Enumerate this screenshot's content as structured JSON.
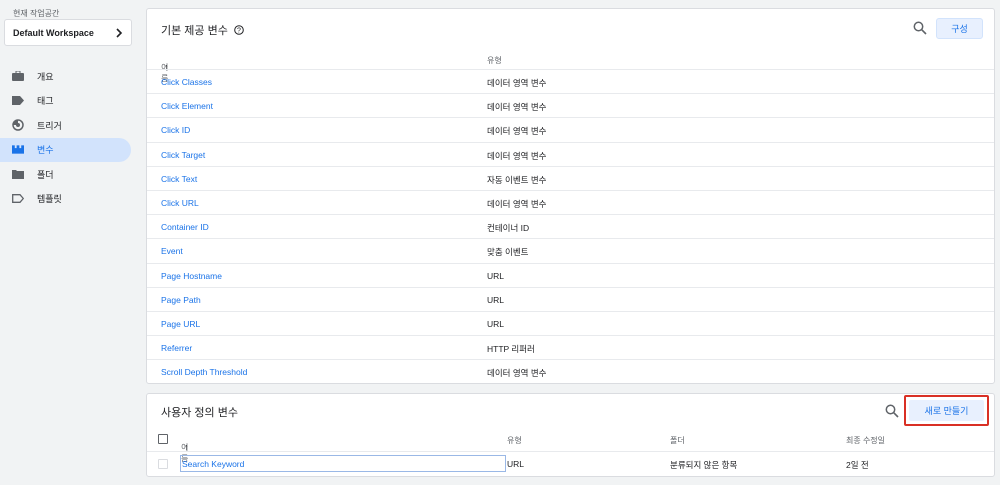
{
  "sidebar": {
    "workspace_label": "현재 작업공간",
    "workspace_name": "Default Workspace",
    "items": [
      {
        "label": "개요",
        "icon": "briefcase-icon",
        "active": false
      },
      {
        "label": "태그",
        "icon": "tag-icon",
        "active": false
      },
      {
        "label": "트리거",
        "icon": "trigger-icon",
        "active": false
      },
      {
        "label": "변수",
        "icon": "variables-icon",
        "active": true
      },
      {
        "label": "폴더",
        "icon": "folder-icon",
        "active": false
      },
      {
        "label": "템플릿",
        "icon": "template-icon",
        "active": false
      }
    ]
  },
  "builtin": {
    "title": "기본 제공 변수",
    "configure_label": "구성",
    "col_name": "이름",
    "col_type": "유형",
    "rows": [
      {
        "name": "Click Classes",
        "type": "데이터 영역 변수"
      },
      {
        "name": "Click Element",
        "type": "데이터 영역 변수"
      },
      {
        "name": "Click ID",
        "type": "데이터 영역 변수"
      },
      {
        "name": "Click Target",
        "type": "데이터 영역 변수"
      },
      {
        "name": "Click Text",
        "type": "자동 이벤트 변수"
      },
      {
        "name": "Click URL",
        "type": "데이터 영역 변수"
      },
      {
        "name": "Container ID",
        "type": "컨테이너 ID"
      },
      {
        "name": "Event",
        "type": "맞춤 이벤트"
      },
      {
        "name": "Page Hostname",
        "type": "URL"
      },
      {
        "name": "Page Path",
        "type": "URL"
      },
      {
        "name": "Page URL",
        "type": "URL"
      },
      {
        "name": "Referrer",
        "type": "HTTP 리퍼러"
      },
      {
        "name": "Scroll Depth Threshold",
        "type": "데이터 영역 변수"
      }
    ]
  },
  "user_defined": {
    "title": "사용자 정의 변수",
    "new_label": "새로 만들기",
    "col_name": "이름",
    "col_type": "유형",
    "col_folder": "폴더",
    "col_modified": "최종 수정일",
    "rows": [
      {
        "name": "Search Keyword",
        "type": "URL",
        "folder": "분류되지 않은 항목",
        "modified": "2일 전"
      }
    ]
  },
  "colors": {
    "accent": "#1a73e8",
    "highlight": "#d93025",
    "active_bg": "#d2e3fc"
  }
}
